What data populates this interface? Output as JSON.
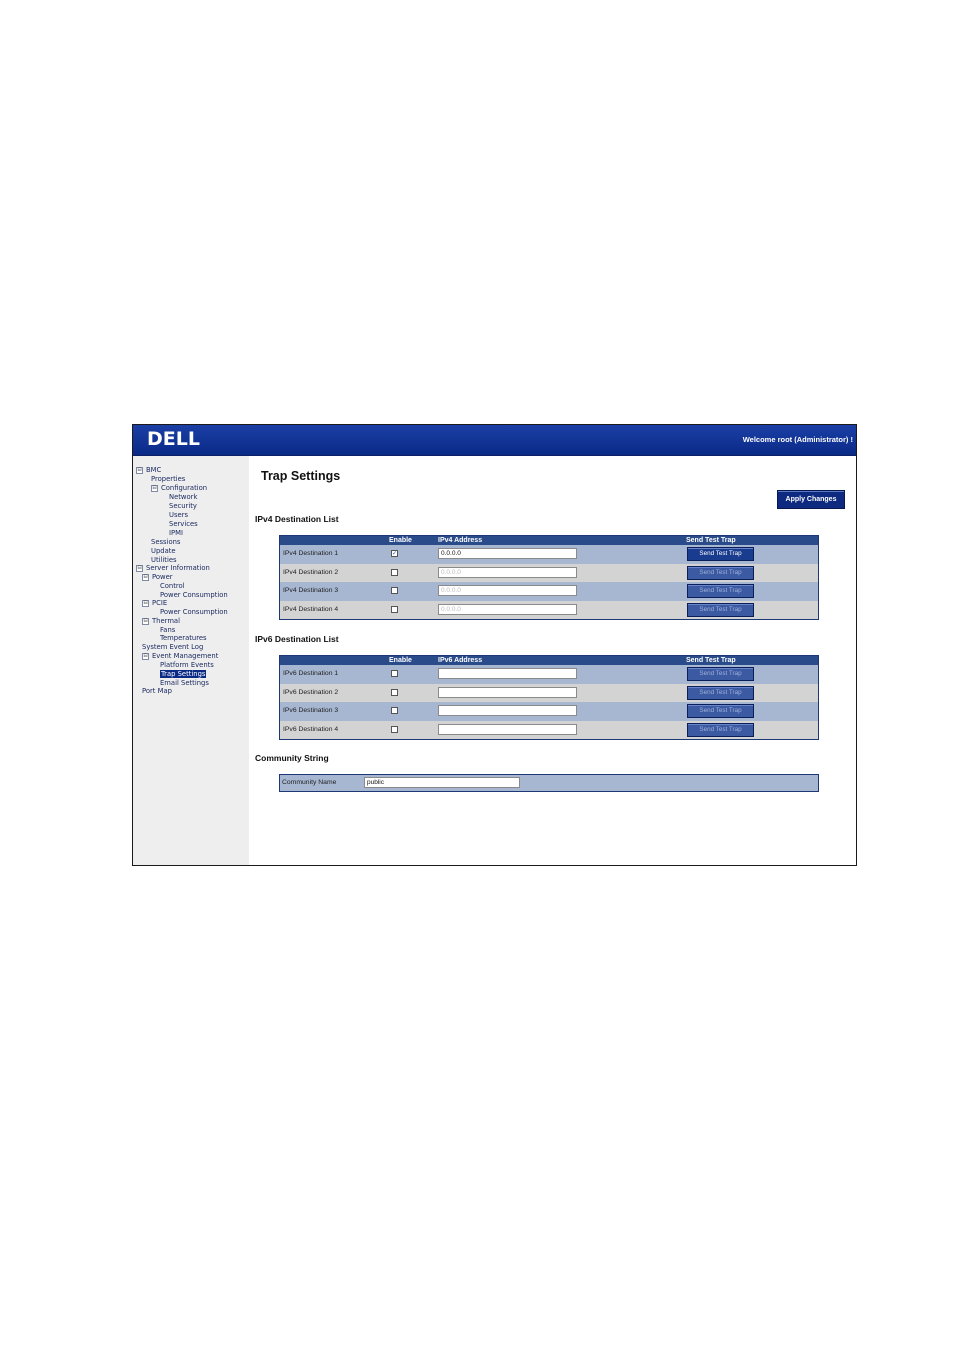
{
  "header": {
    "logo": "DELL",
    "welcome": "Welcome root (Administrator) !"
  },
  "sidebar": {
    "bmc": "BMC",
    "properties": "Properties",
    "configuration": "Configuration",
    "network": "Network",
    "security": "Security",
    "users": "Users",
    "services": "Services",
    "ipmi": "IPMI",
    "sessions": "Sessions",
    "update": "Update",
    "utilities": "Utilities",
    "server_information": "Server Information",
    "power": "Power",
    "control": "Control",
    "power_consumption": "Power Consumption",
    "pcie": "PCIE",
    "pcie_power_consumption": "Power Consumption",
    "thermal": "Thermal",
    "fans": "Fans",
    "temperatures": "Temperatures",
    "system_event_log": "System Event Log",
    "event_management": "Event Management",
    "platform_events": "Platform Events",
    "trap_settings": "Trap Settings",
    "email_settings": "Email Settings",
    "port_map": "Port Map",
    "toggle_glyph": "⊟"
  },
  "main": {
    "title": "Trap Settings",
    "apply_label": "Apply Changes"
  },
  "ipv4": {
    "title": "IPv4 Destination List",
    "col_enable": "Enable",
    "col_address": "IPv4 Address",
    "col_trap": "Send Test Trap",
    "rows": [
      {
        "label": "IPv4 Destination 1",
        "checked": "✓",
        "address": "0.0.0.0",
        "button": "Send Test Trap"
      },
      {
        "label": "IPv4 Destination 2",
        "checked": "",
        "address": "0.0.0.0",
        "button": "Send Test Trap"
      },
      {
        "label": "IPv4 Destination 3",
        "checked": "",
        "address": "0.0.0.0",
        "button": "Send Test Trap"
      },
      {
        "label": "IPv4 Destination 4",
        "checked": "",
        "address": "0.0.0.0",
        "button": "Send Test Trap"
      }
    ]
  },
  "ipv6": {
    "title": "IPv6 Destination List",
    "col_enable": "Enable",
    "col_address": "IPv6 Address",
    "col_trap": "Send Test Trap",
    "rows": [
      {
        "label": "IPv6 Destination 1",
        "address": "",
        "button": "Send Test Trap"
      },
      {
        "label": "IPv6 Destination 2",
        "address": "",
        "button": "Send Test Trap"
      },
      {
        "label": "IPv6 Destination 3",
        "address": "",
        "button": "Send Test Trap"
      },
      {
        "label": "IPv6 Destination 4",
        "address": "",
        "button": "Send Test Trap"
      }
    ]
  },
  "community": {
    "title": "Community String",
    "label": "Community Name",
    "value": "public"
  },
  "colors": {
    "header": "#0a2a86",
    "table_head": "#2a4b8a",
    "row_odd": "#a7b7d1",
    "row_even": "#d3d3d3",
    "sidebar_bg": "#eeeeee"
  }
}
